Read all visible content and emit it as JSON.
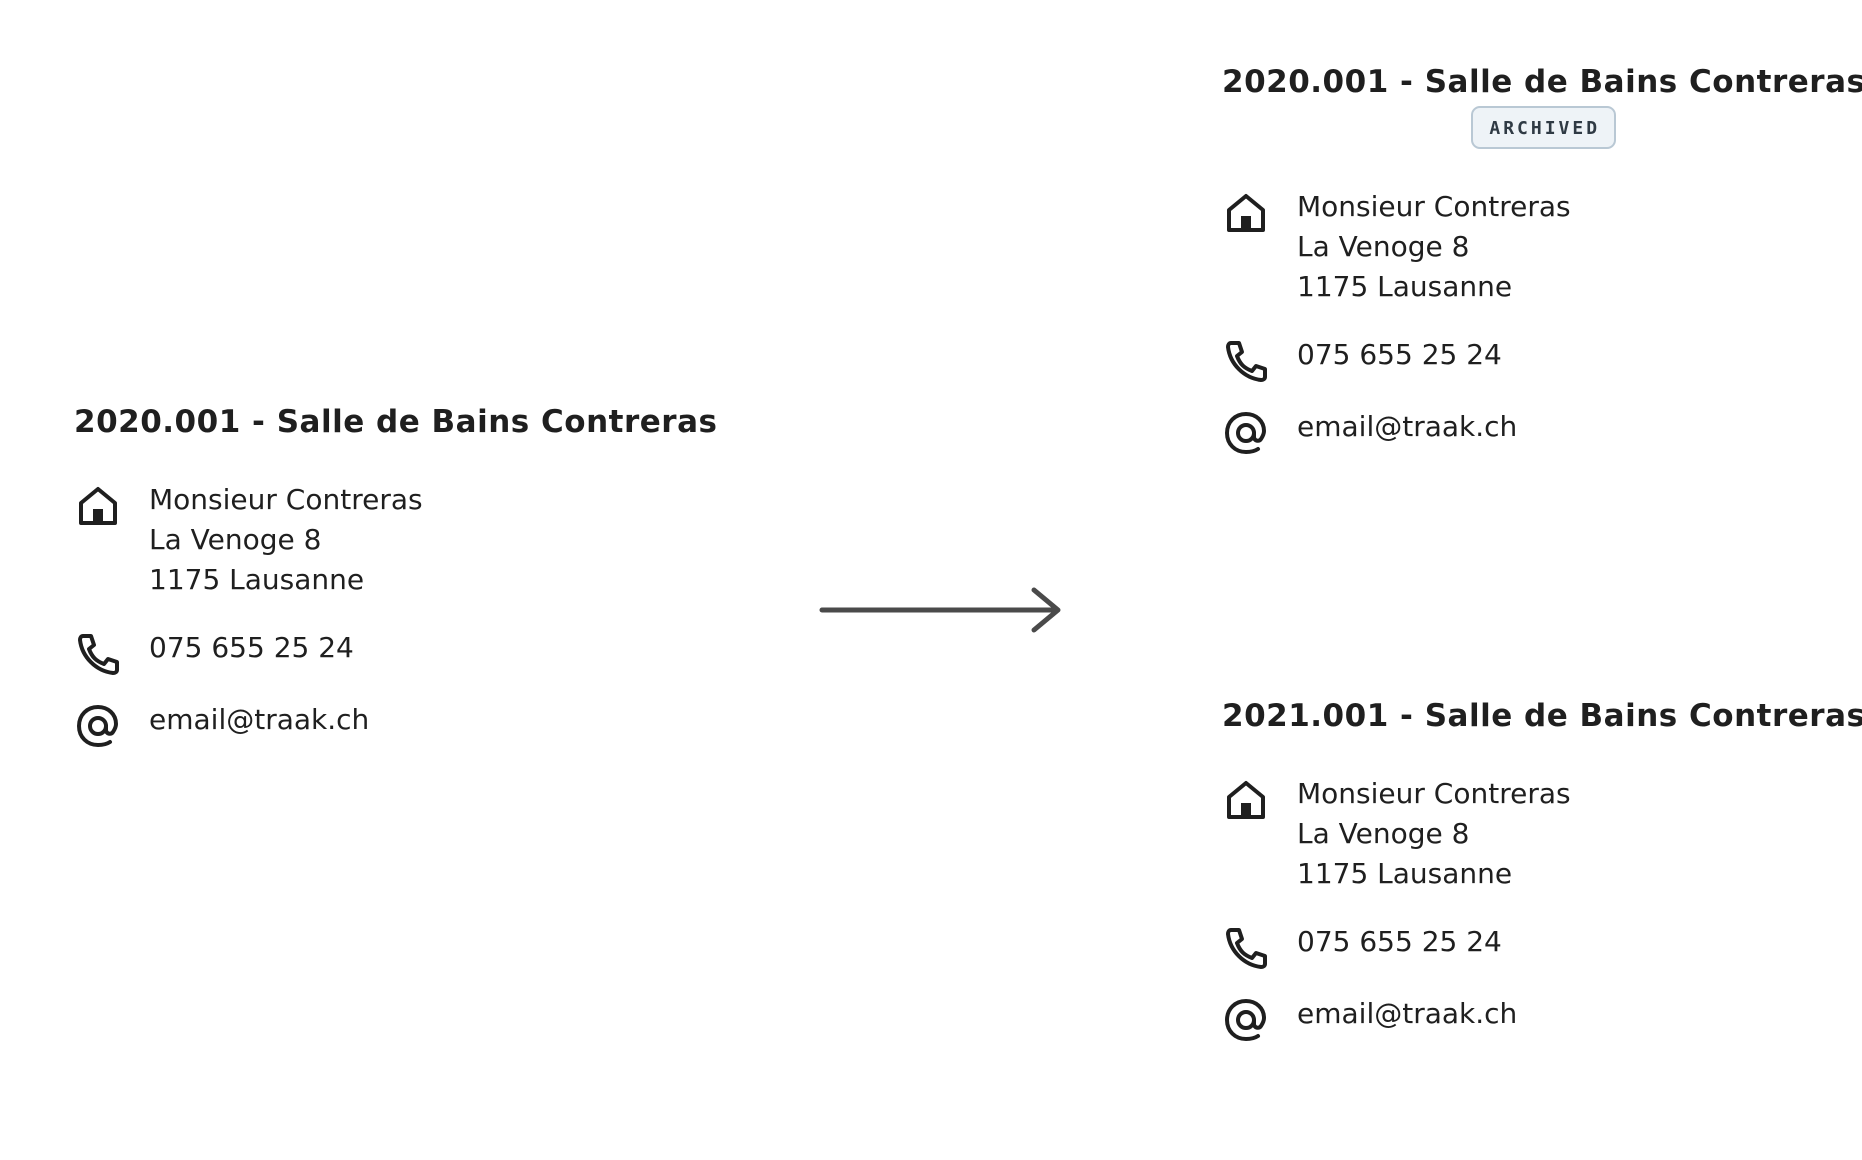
{
  "source_project": {
    "title": "2020.001 - Salle de Bains Contreras",
    "address_lines": [
      "Monsieur Contreras",
      "La Venoge 8",
      "1175 Lausanne"
    ],
    "phone": "075 655 25 24",
    "email": "email@traak.ch"
  },
  "archived_project": {
    "title": "2020.001 - Salle de Bains Contreras",
    "badge": "ARCHIVED",
    "address_lines": [
      "Monsieur Contreras",
      "La Venoge 8",
      "1175 Lausanne"
    ],
    "phone": "075 655 25 24",
    "email": "email@traak.ch"
  },
  "new_project": {
    "title": "2021.001 - Salle de Bains Contreras",
    "address_lines": [
      "Monsieur Contreras",
      "La Venoge 8",
      "1175 Lausanne"
    ],
    "phone": "075 655 25 24",
    "email": "email@traak.ch"
  },
  "icons": {
    "address": "home-icon",
    "phone": "phone-icon",
    "email": "at-sign-icon",
    "transition": "arrow-right-icon"
  },
  "colors": {
    "text": "#1f1f1f",
    "arrow": "#4a4a4a",
    "badge_bg": "#eef3f7",
    "badge_border": "#b9c8d4"
  }
}
